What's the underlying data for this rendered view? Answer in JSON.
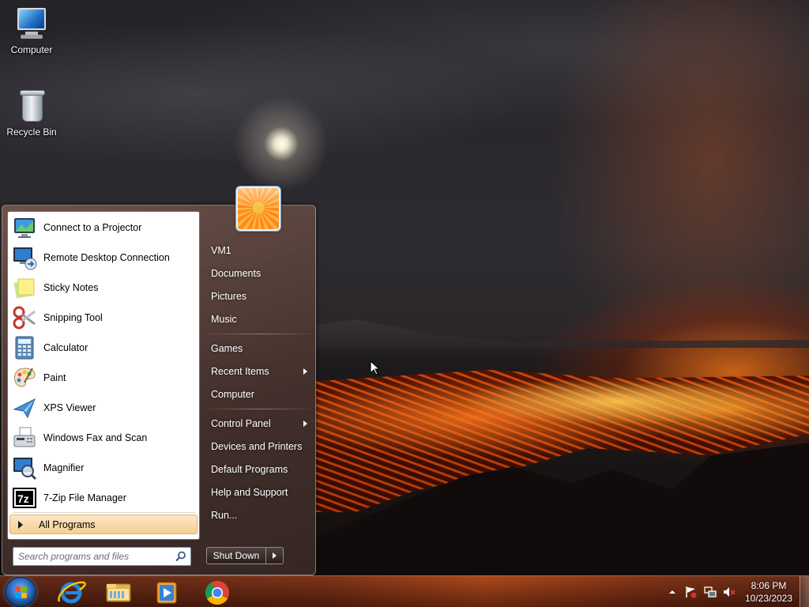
{
  "desktop": {
    "icons": [
      {
        "label": "Computer",
        "icon": "computer-icon"
      },
      {
        "label": "Recycle Bin",
        "icon": "recycle-bin-icon"
      }
    ]
  },
  "start_menu": {
    "pinned_programs": [
      {
        "label": "Connect to a Projector",
        "icon": "projector-icon"
      },
      {
        "label": "Remote Desktop Connection",
        "icon": "remote-desktop-icon"
      },
      {
        "label": "Sticky Notes",
        "icon": "sticky-notes-icon"
      },
      {
        "label": "Snipping Tool",
        "icon": "scissors-icon"
      },
      {
        "label": "Calculator",
        "icon": "calculator-icon"
      },
      {
        "label": "Paint",
        "icon": "paint-palette-icon"
      },
      {
        "label": "XPS Viewer",
        "icon": "xps-viewer-icon"
      },
      {
        "label": "Windows Fax and Scan",
        "icon": "fax-icon"
      },
      {
        "label": "Magnifier",
        "icon": "magnifier-icon"
      },
      {
        "label": "7-Zip File Manager",
        "icon": "7zip-icon"
      }
    ],
    "all_programs_label": "All Programs",
    "search_placeholder": "Search programs and files",
    "right_items": [
      {
        "label": "VM1",
        "submenu": false
      },
      {
        "label": "Documents",
        "submenu": false
      },
      {
        "label": "Pictures",
        "submenu": false
      },
      {
        "label": "Music",
        "submenu": false
      },
      {
        "label": "Games",
        "submenu": false
      },
      {
        "label": "Recent Items",
        "submenu": true
      },
      {
        "label": "Computer",
        "submenu": false
      },
      {
        "label": "Control Panel",
        "submenu": true
      },
      {
        "label": "Devices and Printers",
        "submenu": false
      },
      {
        "label": "Default Programs",
        "submenu": false
      },
      {
        "label": "Help and Support",
        "submenu": false
      },
      {
        "label": "Run...",
        "submenu": false
      }
    ],
    "shutdown_label": "Shut Down"
  },
  "taskbar": {
    "pinned": [
      {
        "name": "Internet Explorer",
        "icon": "internet-explorer-icon"
      },
      {
        "name": "Windows Explorer",
        "icon": "folder-icon"
      },
      {
        "name": "Windows Media Player",
        "icon": "media-player-icon"
      },
      {
        "name": "Google Chrome",
        "icon": "chrome-icon"
      }
    ],
    "tray_icons": [
      "show-hidden-icons-icon",
      "action-center-flag-icon",
      "network-icon",
      "volume-muted-icon"
    ],
    "clock": {
      "time": "8:06 PM",
      "date": "10/23/2023"
    }
  },
  "colors": {
    "all_programs_highlight": "#f6cf91",
    "start_orb": "#2a6fc2",
    "menu_frame": "#5a4540"
  }
}
